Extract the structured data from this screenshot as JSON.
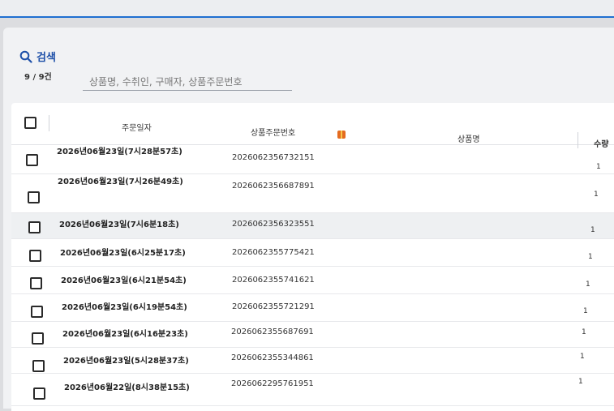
{
  "search": {
    "title": "검색",
    "count": "9 / 9건",
    "placeholder": "상품명, 수취인, 구매자, 상품주문번호"
  },
  "table": {
    "headers": {
      "order_date": "주문일자",
      "product_order_no": "상품주문번호",
      "product_name": "상품명",
      "quantity": "수량"
    },
    "rows": [
      {
        "date": "2026년06월23일(7시28분57초)",
        "order_no": "2026062356732151",
        "qty": "1"
      },
      {
        "date": "2026년06월23일(7시26분49초)",
        "order_no": "2026062356687891",
        "qty": "1"
      },
      {
        "date": "2026년06월23일(7시6분18초)",
        "order_no": "2026062356323551",
        "qty": "1"
      },
      {
        "date": "2026년06월23일(6시25분17초)",
        "order_no": "2026062355775421",
        "qty": "1"
      },
      {
        "date": "2026년06월23일(6시21분54초)",
        "order_no": "2026062355741621",
        "qty": "1"
      },
      {
        "date": "2026년06월23일(6시19분54초)",
        "order_no": "2026062355721291",
        "qty": "1"
      },
      {
        "date": "2026년06월23일(6시16분23초)",
        "order_no": "2026062355687691",
        "qty": "1"
      },
      {
        "date": "2026년06월23일(5시28분37초)",
        "order_no": "2026062355344861",
        "qty": "1"
      },
      {
        "date": "2026년06월22일(8시38분15초)",
        "order_no": "2026062295761951",
        "qty": "1"
      }
    ]
  },
  "icons": {
    "search": "search-icon",
    "gift": "gift-icon"
  },
  "colors": {
    "accent": "#1d4fa8",
    "top_bar_line": "#1f6fd1"
  }
}
